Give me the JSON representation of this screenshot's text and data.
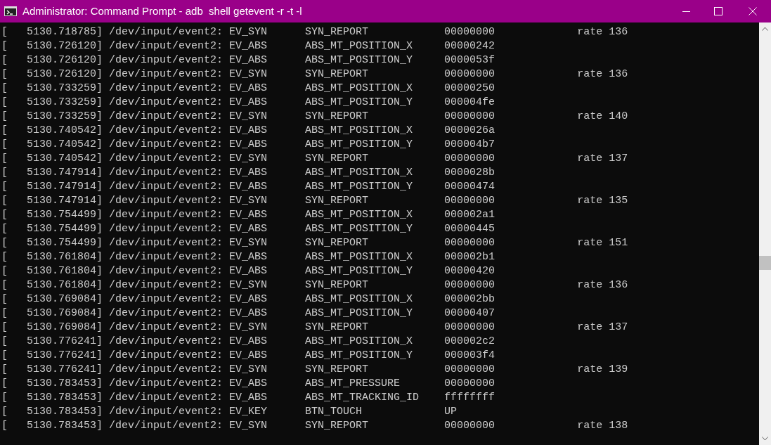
{
  "window": {
    "title": "Administrator: Command Prompt - adb  shell getevent -r -t -l"
  },
  "console": {
    "lines": [
      "[   5130.718785] /dev/input/event2: EV_SYN      SYN_REPORT            00000000             rate 136",
      "[   5130.726120] /dev/input/event2: EV_ABS      ABS_MT_POSITION_X     00000242",
      "[   5130.726120] /dev/input/event2: EV_ABS      ABS_MT_POSITION_Y     0000053f",
      "[   5130.726120] /dev/input/event2: EV_SYN      SYN_REPORT            00000000             rate 136",
      "[   5130.733259] /dev/input/event2: EV_ABS      ABS_MT_POSITION_X     00000250",
      "[   5130.733259] /dev/input/event2: EV_ABS      ABS_MT_POSITION_Y     000004fe",
      "[   5130.733259] /dev/input/event2: EV_SYN      SYN_REPORT            00000000             rate 140",
      "[   5130.740542] /dev/input/event2: EV_ABS      ABS_MT_POSITION_X     0000026a",
      "[   5130.740542] /dev/input/event2: EV_ABS      ABS_MT_POSITION_Y     000004b7",
      "[   5130.740542] /dev/input/event2: EV_SYN      SYN_REPORT            00000000             rate 137",
      "[   5130.747914] /dev/input/event2: EV_ABS      ABS_MT_POSITION_X     0000028b",
      "[   5130.747914] /dev/input/event2: EV_ABS      ABS_MT_POSITION_Y     00000474",
      "[   5130.747914] /dev/input/event2: EV_SYN      SYN_REPORT            00000000             rate 135",
      "[   5130.754499] /dev/input/event2: EV_ABS      ABS_MT_POSITION_X     000002a1",
      "[   5130.754499] /dev/input/event2: EV_ABS      ABS_MT_POSITION_Y     00000445",
      "[   5130.754499] /dev/input/event2: EV_SYN      SYN_REPORT            00000000             rate 151",
      "[   5130.761804] /dev/input/event2: EV_ABS      ABS_MT_POSITION_X     000002b1",
      "[   5130.761804] /dev/input/event2: EV_ABS      ABS_MT_POSITION_Y     00000420",
      "[   5130.761804] /dev/input/event2: EV_SYN      SYN_REPORT            00000000             rate 136",
      "[   5130.769084] /dev/input/event2: EV_ABS      ABS_MT_POSITION_X     000002bb",
      "[   5130.769084] /dev/input/event2: EV_ABS      ABS_MT_POSITION_Y     00000407",
      "[   5130.769084] /dev/input/event2: EV_SYN      SYN_REPORT            00000000             rate 137",
      "[   5130.776241] /dev/input/event2: EV_ABS      ABS_MT_POSITION_X     000002c2",
      "[   5130.776241] /dev/input/event2: EV_ABS      ABS_MT_POSITION_Y     000003f4",
      "[   5130.776241] /dev/input/event2: EV_SYN      SYN_REPORT            00000000             rate 139",
      "[   5130.783453] /dev/input/event2: EV_ABS      ABS_MT_PRESSURE       00000000",
      "[   5130.783453] /dev/input/event2: EV_ABS      ABS_MT_TRACKING_ID    ffffffff",
      "[   5130.783453] /dev/input/event2: EV_KEY      BTN_TOUCH             UP",
      "[   5130.783453] /dev/input/event2: EV_SYN      SYN_REPORT            00000000             rate 138"
    ]
  }
}
